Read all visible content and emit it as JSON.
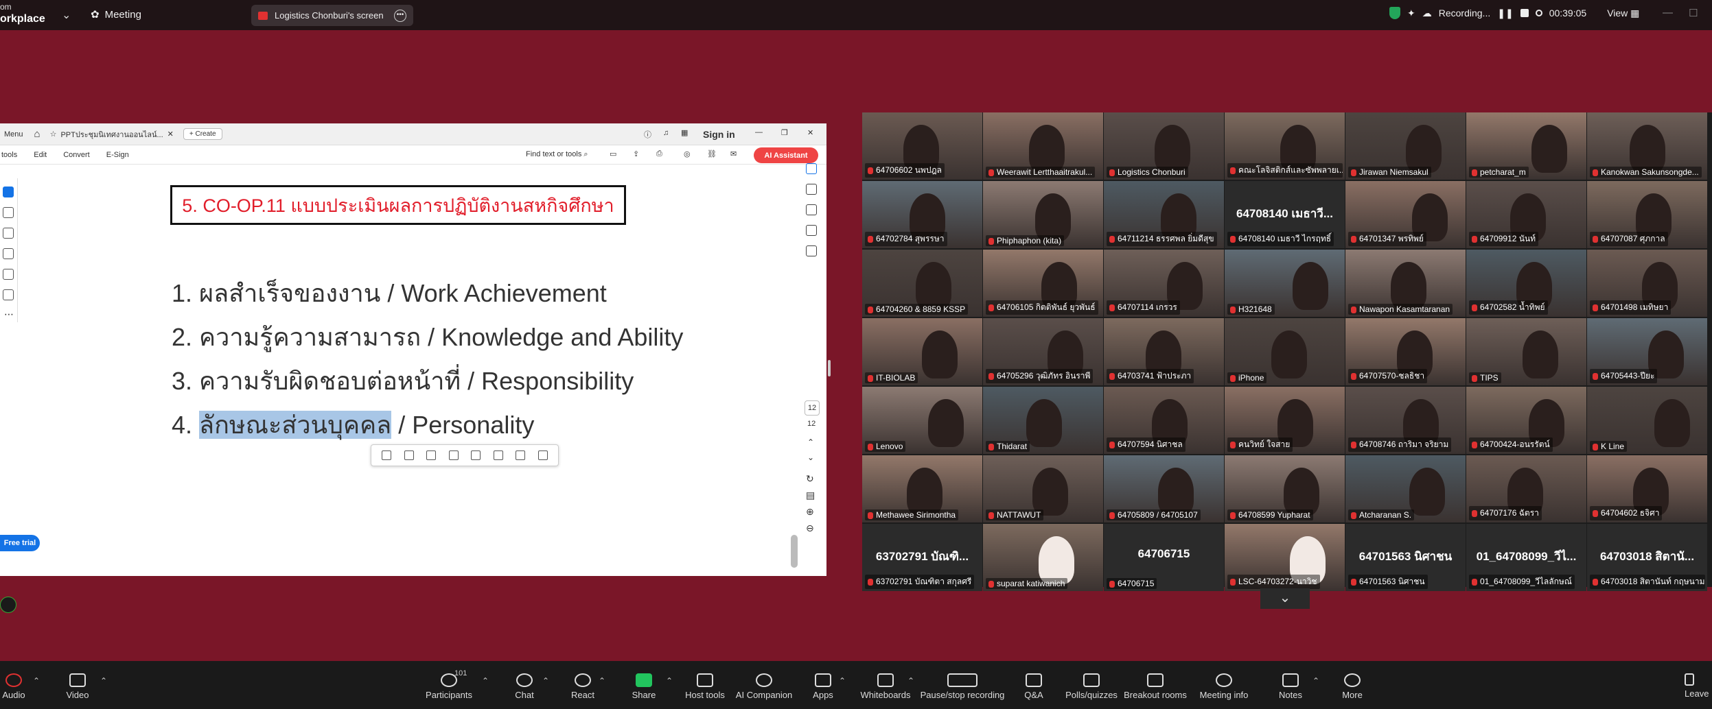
{
  "topbar": {
    "brand_line1": "om",
    "brand_line2": "orkplace",
    "meeting_label": "Meeting",
    "screen_label": "Logistics Chonburi's screen",
    "recording_label": "Recording...",
    "timer": "00:39:05",
    "view_label": "View"
  },
  "pdf": {
    "tab_menu": "Menu",
    "tab_title": "PPTประชุมนิเทศงานออนไลน์...",
    "create_label": "+ Create",
    "sign_in": "Sign in",
    "menu_tools": "tools",
    "menu_edit": "Edit",
    "menu_convert": "Convert",
    "menu_esign": "E-Sign",
    "find_text": "Find text or tools",
    "ai_assistant": "AI Assistant",
    "free_trial": "Free trial",
    "page_current": "12",
    "page_total": "12",
    "title": "5. CO-OP.11 แบบประเมินผลการปฏิบัติงานสหกิจศึกษา",
    "items": [
      {
        "num": "1.",
        "text": "ผลสำเร็จของงาน / Work Achievement"
      },
      {
        "num": "2.",
        "text": "ความรู้ความสามารถ / Knowledge and Ability"
      },
      {
        "num": "3.",
        "text": "ความรับผิดชอบต่อหน้าที่ / Responsibility"
      },
      {
        "num": "4.",
        "highlight": "ลักษณะส่วนบุคคล",
        "text": " / Personality"
      }
    ]
  },
  "gallery": {
    "tiles": [
      {
        "name": "64706602 นพปฎล",
        "type": "video"
      },
      {
        "name": "Weerawit Lertthaaitrakul...",
        "type": "video"
      },
      {
        "name": "Logistics Chonburi",
        "type": "video",
        "active": true
      },
      {
        "name": "คณะโลจิสติกส์และซัพพลายเ...",
        "type": "video"
      },
      {
        "name": "Jirawan Niemsakul",
        "type": "video"
      },
      {
        "name": "petcharat_m",
        "type": "video"
      },
      {
        "name": "Kanokwan Sakunsongde...",
        "type": "video"
      },
      {
        "name": "64702784 สุพรรษา",
        "type": "video"
      },
      {
        "name": "Phiphaphon (kita)",
        "type": "video"
      },
      {
        "name": "64711214 ธรรศพล ยิ่มดีสุข",
        "type": "video"
      },
      {
        "name": "64708140 เมธาวี ไกรฤทธิ์",
        "type": "avatar",
        "big": "64708140 เมธาวี..."
      },
      {
        "name": "64701347 พรทิพย์",
        "type": "video"
      },
      {
        "name": "64709912 นันท์",
        "type": "video"
      },
      {
        "name": "64707087 ศุภกาล",
        "type": "video"
      },
      {
        "name": "64704260 & 8859 KSSP",
        "type": "video"
      },
      {
        "name": "64706105 กิตติพันธ์ ยุวพันธ์",
        "type": "video"
      },
      {
        "name": "64707114 เกรวร",
        "type": "video"
      },
      {
        "name": "H321648",
        "type": "video"
      },
      {
        "name": "Nawapon Kasamtaranan",
        "type": "video"
      },
      {
        "name": "64702582 น้ำทิพย์",
        "type": "video"
      },
      {
        "name": "64701498 เมทิษยา",
        "type": "video"
      },
      {
        "name": "IT-BIOLAB",
        "type": "video"
      },
      {
        "name": "64705296 วุฒิภัทร อินราพี",
        "type": "video"
      },
      {
        "name": "64703741 ฟ้าประภา",
        "type": "video"
      },
      {
        "name": "iPhone",
        "type": "video"
      },
      {
        "name": "64707570-ชลธิชา",
        "type": "video"
      },
      {
        "name": "TIPS",
        "type": "video"
      },
      {
        "name": "64705443-ปียะ",
        "type": "video"
      },
      {
        "name": "Lenovo",
        "type": "video"
      },
      {
        "name": "Thidarat",
        "type": "video"
      },
      {
        "name": "64707594 นิศาชล",
        "type": "video"
      },
      {
        "name": "คนวิทย์ ใจสาย",
        "type": "video"
      },
      {
        "name": "64708746 ถาริมา จริยาม",
        "type": "video"
      },
      {
        "name": "64700424-อนรรัตน์",
        "type": "video"
      },
      {
        "name": "K Line",
        "type": "video"
      },
      {
        "name": "Methawee Sirimontha",
        "type": "video"
      },
      {
        "name": "NATTAWUT",
        "type": "video"
      },
      {
        "name": "64705809 / 64705107",
        "type": "video"
      },
      {
        "name": "64708599 Yupharat",
        "type": "video"
      },
      {
        "name": "Atcharanan S.",
        "type": "video"
      },
      {
        "name": "64707176 ฉัตรา",
        "type": "video"
      },
      {
        "name": "64704602 ธจิศา",
        "type": "video"
      },
      {
        "name": "63702791 บัณฑิตา สกุลศรี",
        "type": "avatar",
        "big": "63702791 บัณฑิ..."
      },
      {
        "name": "suparat katiwanich",
        "type": "photo"
      },
      {
        "name": "64706715",
        "type": "avatar",
        "big": "64706715"
      },
      {
        "name": "LSC-64703272-นาวิช",
        "type": "photo"
      },
      {
        "name": "64701563 นิศาชน",
        "type": "avatar",
        "big": "64701563 นิศาชน"
      },
      {
        "name": "01_64708099_วีไลลักษณ์",
        "type": "avatar",
        "big": "01_64708099_วีไ..."
      },
      {
        "name": "64703018 สิตานันท์ กฤษนาม",
        "type": "avatar",
        "big": "64703018 สิตานั..."
      }
    ]
  },
  "toolbar": {
    "audio": "Audio",
    "video": "Video",
    "participants": "Participants",
    "participants_count": "101",
    "chat": "Chat",
    "react": "React",
    "share": "Share",
    "host_tools": "Host tools",
    "ai_companion": "AI Companion",
    "apps": "Apps",
    "whiteboards": "Whiteboards",
    "recording": "Pause/stop recording",
    "qa": "Q&A",
    "polls": "Polls/quizzes",
    "breakout": "Breakout rooms",
    "meeting_info": "Meeting info",
    "notes": "Notes",
    "more": "More",
    "leave": "Leave"
  },
  "colors": {
    "background": "#7a1628",
    "accent_red": "#e11d2a",
    "active_green": "#2fce6a",
    "adobe_blue": "#1473e6"
  }
}
